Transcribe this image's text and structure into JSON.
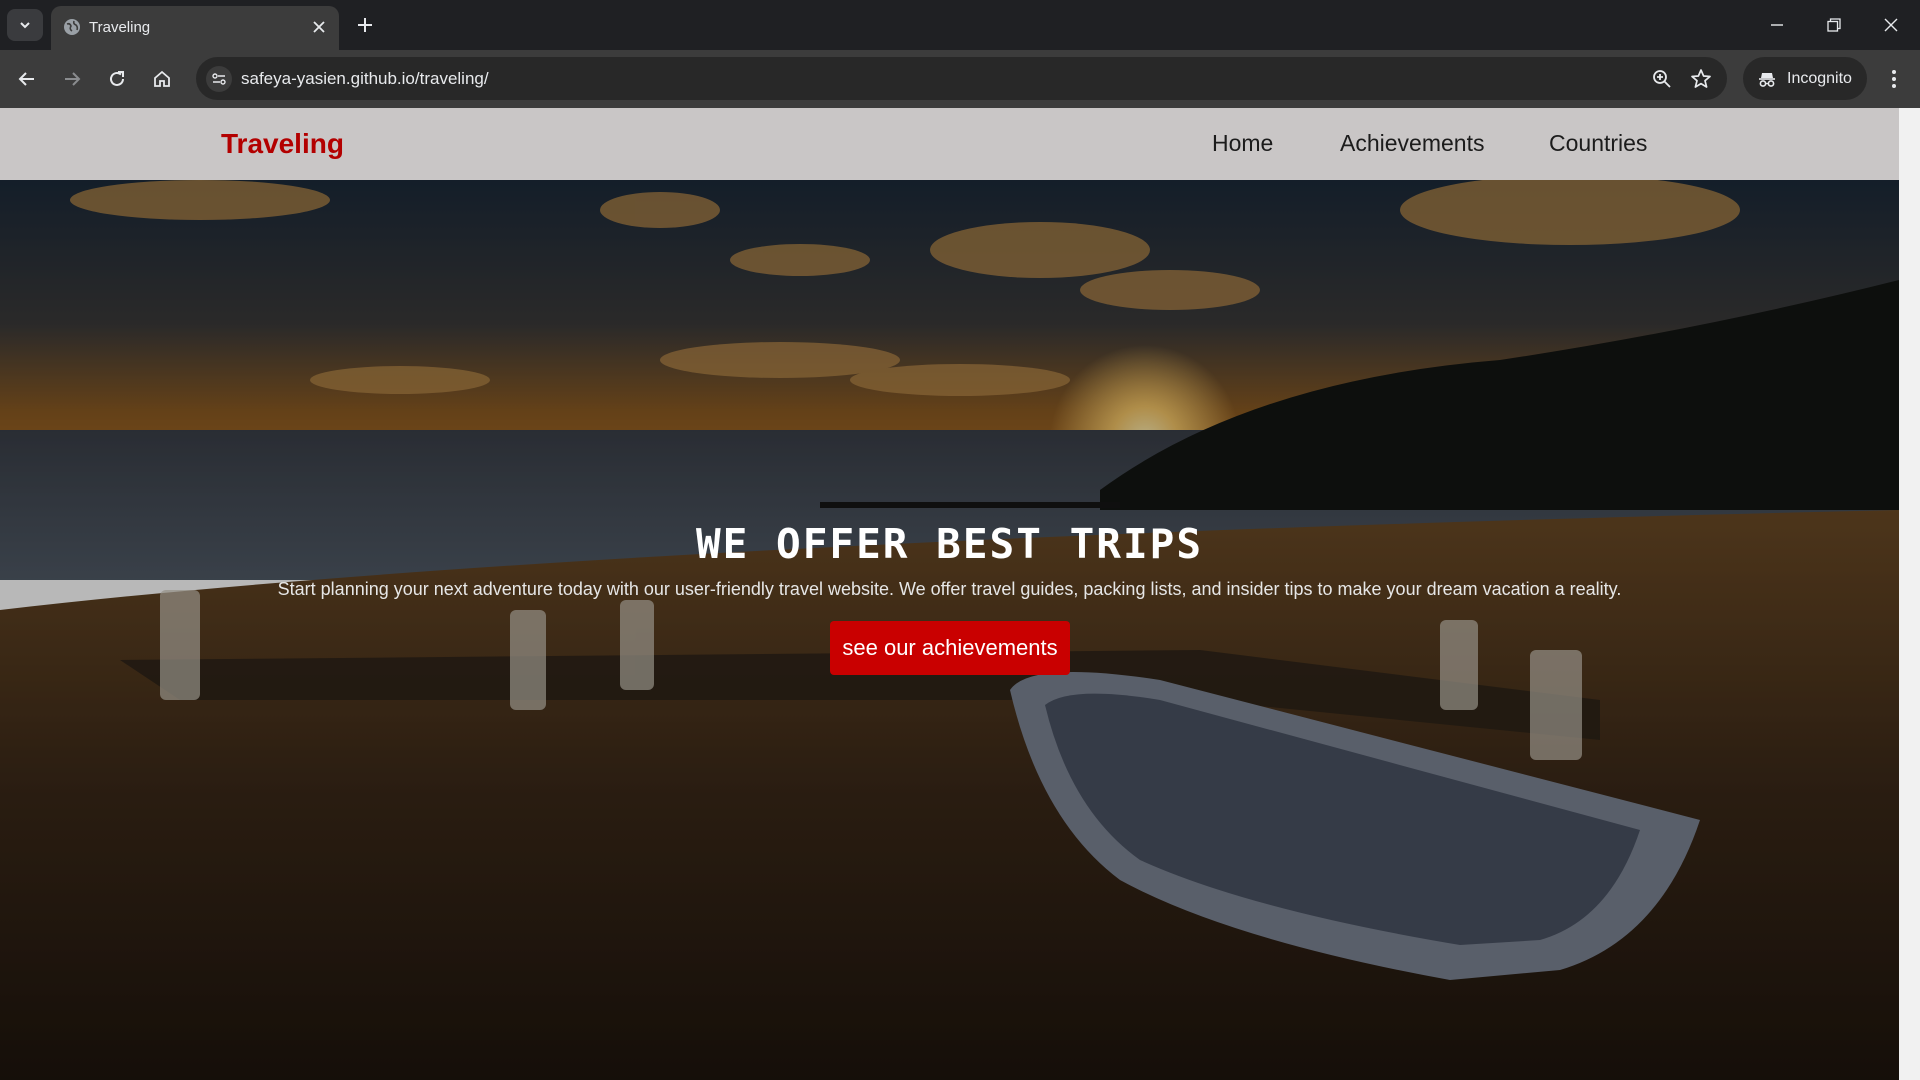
{
  "browser": {
    "tab_title": "Traveling",
    "url": "safeya-yasien.github.io/traveling/",
    "incognito_label": "Incognito",
    "icons": [
      "tab-list-icon",
      "globe-icon",
      "close-icon",
      "plus-icon",
      "minimize-icon",
      "restore-icon",
      "window-close-icon",
      "back-icon",
      "forward-icon",
      "reload-icon",
      "home-icon",
      "site-info-icon",
      "zoom-icon",
      "star-icon",
      "incognito-icon",
      "more-vert-icon"
    ]
  },
  "site": {
    "logo": "Traveling",
    "nav": [
      {
        "label": "Home"
      },
      {
        "label": "Achievements"
      },
      {
        "label": "Countries"
      }
    ],
    "hero": {
      "title": "WE OFFER BEST TRIPS",
      "text": "Start planning your next adventure today with our user-friendly travel website. We offer travel guides, packing lists, and insider tips to make your dream vacation a reality.",
      "button": "see our achievements"
    }
  },
  "colors": {
    "brand": "#b30000",
    "button": "#c90000",
    "header_bg": "#c9c6c6"
  }
}
